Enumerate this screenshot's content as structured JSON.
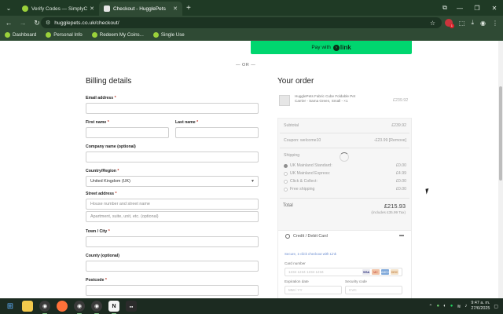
{
  "browser": {
    "tabs": [
      {
        "title": "Verify Codes — SimplyCodes",
        "favicon_color": "#9bd13b",
        "active": false
      },
      {
        "title": "Checkout - HugglePets",
        "favicon_color": "#e5e5e5",
        "active": true
      }
    ],
    "url": "hugglepets.co.uk/checkout/",
    "bookmarks": [
      "Dashboard",
      "Personal Info",
      "Redeem My Coins...",
      "Single Use"
    ]
  },
  "page": {
    "pay_with_label": "Pay with",
    "link_brand": "link",
    "or_text": "— OR —",
    "billing": {
      "heading": "Billing details",
      "email_label": "Email address",
      "first_name_label": "First name",
      "last_name_label": "Last name",
      "company_label": "Company name (optional)",
      "country_label": "Country/Region",
      "country_value": "United Kingdom (UK)",
      "street_label": "Street address",
      "street_placeholder": "House number and street name",
      "street2_placeholder": "Apartment, suite, unit, etc. (optional)",
      "town_label": "Town / City",
      "county_label": "County (optional)",
      "postcode_label": "Postcode",
      "required_mark": "*"
    },
    "order": {
      "heading": "Your order",
      "product_name": "HugglePets Fabric Cube Foldable Pet Carrier - Sama Green, Small - ×1",
      "product_price": "£239.92",
      "subtotal_label": "Subtotal",
      "subtotal_value": "£239.92",
      "coupon_label": "Coupon: welcome10",
      "coupon_value": "-£23.99 [Remove]",
      "shipping_label": "Shipping",
      "shipping_options": [
        {
          "label": "UK Mainland Standard:",
          "price": "£0.00",
          "selected": true
        },
        {
          "label": "UK Mainland Express:",
          "price": "£4.99",
          "selected": false
        },
        {
          "label": "Click & Collect:",
          "price": "£0.00",
          "selected": false
        },
        {
          "label": "Free shipping",
          "price": "£0.00",
          "selected": false
        }
      ],
      "total_label": "Total",
      "total_value": "£215.93",
      "tax_note": "(includes £35.99 Tax)"
    },
    "payment": {
      "method_label": "Credit / Debit Card",
      "secure_note": "Secure, 1-click checkout with Link",
      "card_number_label": "Card number",
      "card_number_placeholder": "1234 1234 1234 1234",
      "expiry_label": "Expiration date",
      "expiry_placeholder": "MM / YY",
      "cvc_label": "Security code",
      "cvc_placeholder": "CVC",
      "card_brands": [
        "VISA",
        "MC",
        "AMEX",
        "DISC"
      ]
    }
  },
  "taskbar": {
    "time": "9:47 a. m.",
    "date": "27/6/2025"
  }
}
